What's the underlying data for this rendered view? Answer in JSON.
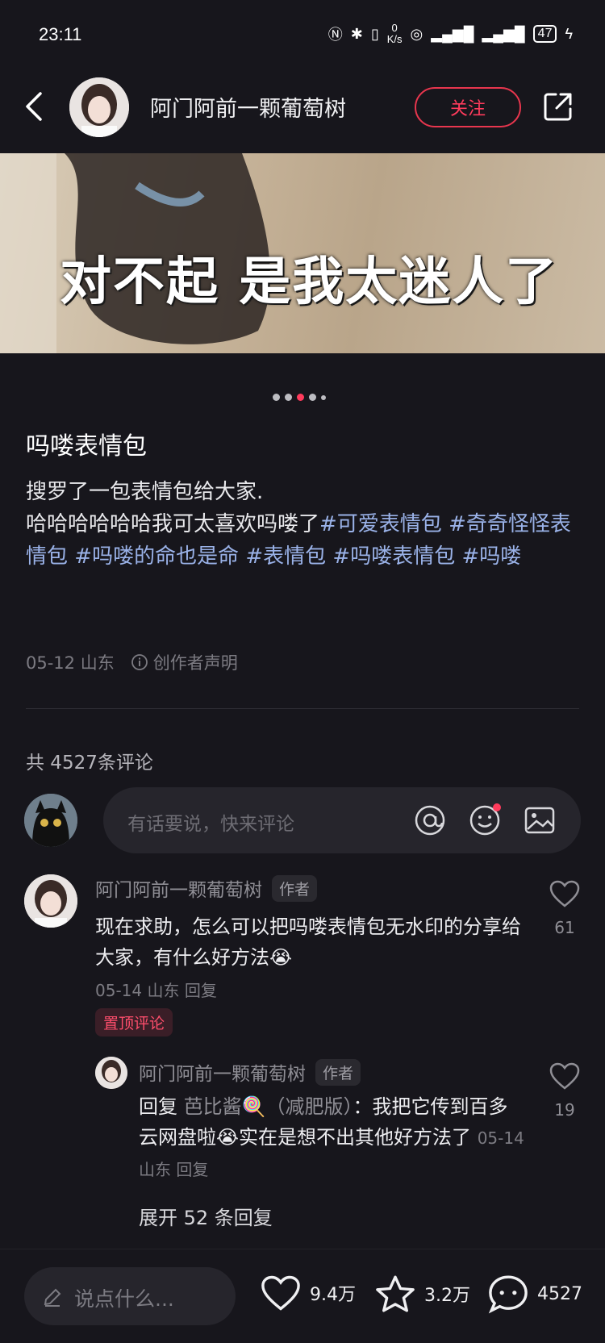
{
  "status": {
    "time": "23:11",
    "net_value": "0",
    "net_unit": "K/s",
    "battery": "47"
  },
  "header": {
    "author": "阿门阿前一颗葡萄树",
    "follow_label": "关注"
  },
  "hero": {
    "overlay_text": "对不起 是我太迷人了",
    "page_dots": 5,
    "active_dot": 3
  },
  "post": {
    "title": "吗喽表情包",
    "line1": "搜罗了一包表情包给大家.",
    "line2_plain": "哈哈哈哈哈哈我可太喜欢吗喽了",
    "tags": [
      "#可爱表情包",
      "#奇奇怪怪表情包",
      "#吗喽的命也是命",
      "#表情包",
      "#吗喽表情包",
      "#吗喽"
    ],
    "date_loc": "05-12 山东",
    "declaration": "创作者声明"
  },
  "comments_header": {
    "count_text": "共 4527条评论"
  },
  "comment_input": {
    "placeholder": "有话要说，快来评论"
  },
  "comments": [
    {
      "name": "阿门阿前一颗葡萄树",
      "badge": "作者",
      "text": "现在求助，怎么可以把吗喽表情包无水印的分享给大家，有什么好方法😭",
      "meta": "05-14 山东 回复",
      "pinned": "置顶评论",
      "likes": "61"
    },
    {
      "name": "阿门阿前一颗葡萄树",
      "badge": "作者",
      "reply_prefix": "回复",
      "reply_to": "芭比酱🍭（减肥版）",
      "text": "：我把它传到百多云网盘啦😭实在是想不出其他好方法了",
      "meta": "05-14 山东 回复",
      "likes": "19"
    }
  ],
  "expand_replies": "展开 52 条回复",
  "bottom_bar": {
    "say_placeholder": "说点什么...",
    "likes": "9.4万",
    "favorites": "3.2万",
    "comments": "4527"
  }
}
